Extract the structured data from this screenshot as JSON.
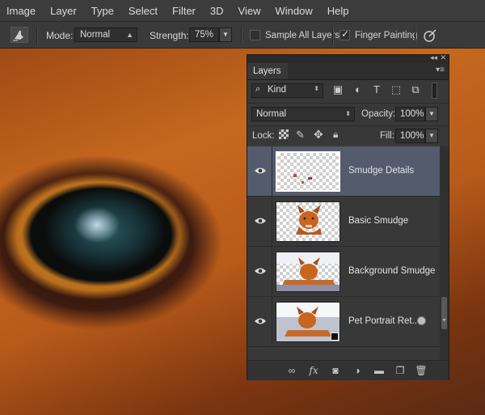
{
  "menu": [
    "Image",
    "Layer",
    "Type",
    "Select",
    "Filter",
    "3D",
    "View",
    "Window",
    "Help"
  ],
  "options": {
    "mode_label": "Mode:",
    "mode_value": "Normal",
    "strength_label": "Strength:",
    "strength_value": "75%",
    "sample_all_layers": {
      "label": "Sample All Layers",
      "checked": false
    },
    "finger_painting": {
      "label": "Finger Painting",
      "checked": true
    }
  },
  "layers_panel": {
    "tab": "Layers",
    "filter_kind": "Kind",
    "blend_mode": "Normal",
    "opacity_label": "Opacity:",
    "opacity_value": "100%",
    "lock_label": "Lock:",
    "fill_label": "Fill:",
    "fill_value": "100%",
    "layers": [
      {
        "name": "Smudge Details",
        "selected": true,
        "visible": true
      },
      {
        "name": "Basic Smudge",
        "selected": false,
        "visible": true
      },
      {
        "name": "Background Smudge",
        "selected": false,
        "visible": true
      },
      {
        "name": "Pet Portrait Ret...",
        "selected": false,
        "visible": true
      }
    ]
  }
}
